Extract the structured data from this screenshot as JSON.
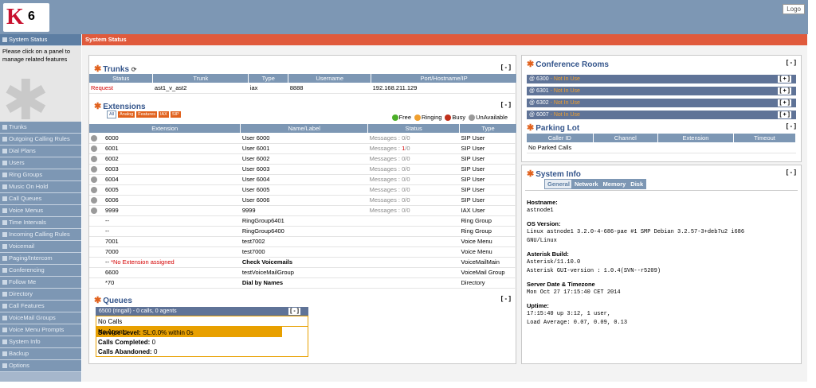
{
  "header": {
    "logo_k": "K",
    "logo_six": "6",
    "logout": "Logo"
  },
  "sidebar": {
    "top_item": "System Status",
    "help": "Please click on a panel to manage related features",
    "items": [
      "Trunks",
      "Outgoing Calling Rules",
      "Dial Plans",
      "Users",
      "Ring Groups",
      "Music On Hold",
      "Call Queues",
      "Voice Menus",
      "Time Intervals",
      "Incoming Calling Rules",
      "Voicemail",
      "Paging/Intercom",
      "Conferencing",
      "Follow Me",
      "Directory",
      "Call Features",
      "VoiceMail Groups",
      "Voice Menu Prompts",
      "System Info",
      "Backup",
      "Options"
    ]
  },
  "main": {
    "title": "System Status"
  },
  "trunks": {
    "title": "Trunks",
    "min": "[ - ]",
    "columns": [
      "Status",
      "Trunk",
      "Type",
      "Username",
      "Port/Hostname/IP"
    ],
    "rows": [
      [
        "Request",
        "ast1_v_ast2",
        "iax",
        "8888",
        "192.168.211.129"
      ]
    ]
  },
  "extensions": {
    "title": "Extensions",
    "min": "[ - ]",
    "filters": [
      "All",
      "Analog",
      "Features",
      "IAX",
      "SIP"
    ],
    "legend": [
      "Free",
      "Ringing",
      "Busy",
      "UnAvailable"
    ],
    "legend_colors": [
      "#4caf28",
      "#f0a030",
      "#c0301c",
      "#9a9a9a"
    ],
    "columns": [
      "Extension",
      "Name/Label",
      "Status",
      "Type"
    ],
    "rows": [
      {
        "ext": "6000",
        "name": "User 6000",
        "status": "Messages : 0/0",
        "type": "SIP User"
      },
      {
        "ext": "6001",
        "name": "User 6001",
        "status_pre": "Messages : ",
        "status_red": "1",
        "status_post": "/0",
        "type": "SIP User"
      },
      {
        "ext": "6002",
        "name": "User 6002",
        "status": "Messages : 0/0",
        "type": "SIP User"
      },
      {
        "ext": "6003",
        "name": "User 6003",
        "status": "Messages : 0/0",
        "type": "SIP User"
      },
      {
        "ext": "6004",
        "name": "User 6004",
        "status": "Messages : 0/0",
        "type": "SIP User"
      },
      {
        "ext": "6005",
        "name": "User 6005",
        "status": "Messages : 0/0",
        "type": "SIP User"
      },
      {
        "ext": "6006",
        "name": "User 6006",
        "status": "Messages : 0/0",
        "type": "SIP User"
      },
      {
        "ext": "9999",
        "name": "9999",
        "status": "Messages : 0/0",
        "type": "IAX User"
      },
      {
        "ext": "--",
        "name": "RingGroup6401",
        "type": "Ring Group"
      },
      {
        "ext": "--",
        "name": "RingGroup6400",
        "type": "Ring Group"
      },
      {
        "ext": "7001",
        "name": "test7002",
        "type": "Voice Menu"
      },
      {
        "ext": "7000",
        "name": "test7000",
        "type": "Voice Menu"
      },
      {
        "ext": "-- ",
        "ext_red": "*No Extension assigned",
        "name": "Check Voicemails",
        "name_bold": true,
        "type": "VoiceMailMain"
      },
      {
        "ext": "6600",
        "name": "testVoiceMailGroup",
        "type": "VoiceMail Group"
      },
      {
        "ext": "*70",
        "name": "Dial by Names",
        "name_bold": true,
        "type": "Directory"
      }
    ]
  },
  "queues": {
    "title": "Queues",
    "min": "[ - ]",
    "header": "6500 (ringall) - 0 calls, 0 agents",
    "header_min": "[ - ]",
    "no_calls": "No Calls",
    "no_agents": "No Agents",
    "service_label": "Service Level:",
    "service_value": " SL:0.0% within 0s",
    "completed_label": "Calls Completed:",
    "completed_value": " 0",
    "abandoned_label": "Calls Abandoned:",
    "abandoned_value": " 0"
  },
  "conference": {
    "title": "Conference Rooms",
    "min": "[ - ]",
    "rooms": [
      {
        "label": "@ 6300",
        "status": " - Not In Use",
        "btn": "[ + ]"
      },
      {
        "label": "@ 6301",
        "status": " - Not In Use",
        "btn": "[ + ]"
      },
      {
        "label": "@ 6302",
        "status": " - Not In Use",
        "btn": "[ + ]"
      },
      {
        "label": "@ 6007",
        "status": " - Not In Use",
        "btn": "[ + ]"
      }
    ]
  },
  "parking": {
    "title": "Parking Lot",
    "min": "[ - ]",
    "columns": [
      "Caller ID",
      "Channel",
      "Extension",
      "Timeout"
    ],
    "empty": "No Parked Calls"
  },
  "sysinfo": {
    "title": "System Info",
    "min": "[ - ]",
    "tabs": [
      "General",
      "Network",
      "Memory",
      "Disk"
    ],
    "sections": [
      {
        "label": "Hostname:",
        "value": [
          "astnode1"
        ]
      },
      {
        "label": "OS Version:",
        "value": [
          "Linux astnode1 3.2.0-4-686-pae #1 SMP Debian 3.2.57-3+deb7u2 i686",
          "GNU/Linux"
        ]
      },
      {
        "label": "Asterisk Build:",
        "value": [
          "Asterisk/11.10.0",
          "Asterisk GUI-version : 1.0.4(SVN--r5209)"
        ]
      },
      {
        "label": "Server Date & Timezone",
        "value": [
          "Mon Oct 27 17:15:40 CET 2014"
        ]
      },
      {
        "label": "Uptime:",
        "value": [
          "17:15:40 up 3:12, 1 user,",
          "Load Average: 0.07, 0.09, 0.13"
        ]
      }
    ]
  }
}
